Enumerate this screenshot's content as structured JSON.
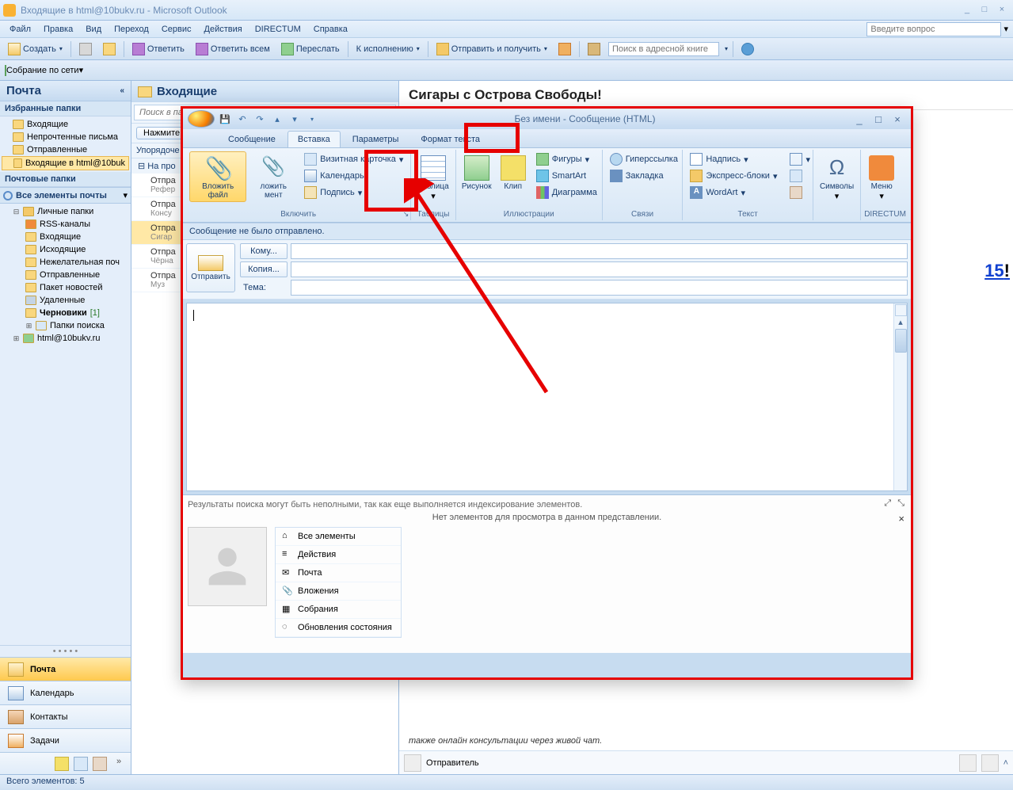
{
  "window": {
    "title": "Входящие в html@10bukv.ru - Microsoft Outlook"
  },
  "menubar": {
    "items": [
      "Файл",
      "Правка",
      "Вид",
      "Переход",
      "Сервис",
      "Действия",
      "DIRECTUM",
      "Справка"
    ],
    "ask_placeholder": "Введите вопрос"
  },
  "toolbar": {
    "create": "Создать",
    "reply": "Ответить",
    "reply_all": "Ответить всем",
    "forward": "Переслать",
    "followup": "К исполнению",
    "sendrecv": "Отправить и получить",
    "addrbook_placeholder": "Поиск в адресной книге"
  },
  "toolbar2": {
    "meeting": "Собрание по сети"
  },
  "nav": {
    "header": "Почта",
    "fav_hdr": "Избранные папки",
    "fav": [
      "Входящие",
      "Непрочтенные письма",
      "Отправленные",
      "Входящие в html@10buk"
    ],
    "mail_hdr": "Почтовые папки",
    "all_items": "Все элементы почты",
    "tree": {
      "root": "Личные папки",
      "children": [
        "RSS-каналы",
        "Входящие",
        "Исходящие",
        "Нежелательная поч",
        "Отправленные",
        "Пакет новостей",
        "Удаленные"
      ],
      "drafts": "Черновики",
      "drafts_count": "[1]",
      "search_folders": "Папки поиска",
      "account": "html@10bukv.ru"
    },
    "buttons": {
      "mail": "Почта",
      "calendar": "Календарь",
      "contacts": "Контакты",
      "tasks": "Задачи"
    }
  },
  "middle": {
    "header": "Входящие",
    "search_placeholder": "Поиск в папке \"Входящие\"",
    "today_btn": "Нажмите",
    "arrange": "Упорядоче",
    "group_header": "На про",
    "messages": [
      {
        "from": "Отпра",
        "sub": "Рефер"
      },
      {
        "from": "Отпра",
        "sub": "Консу"
      },
      {
        "from": "Отпра",
        "sub": "Сигар"
      },
      {
        "from": "Отпра",
        "sub": "Чёрна"
      },
      {
        "from": "Отпра",
        "sub": "Муз"
      }
    ]
  },
  "reading": {
    "subject": "Сигары с Острова Свободы!",
    "big_fragment": "15",
    "body_line": "также онлайн консультации через живой чат.",
    "sender_label": "Отправитель"
  },
  "compose": {
    "title": "Без имени - Сообщение (HTML)",
    "tabs": [
      "Сообщение",
      "Вставка",
      "Параметры",
      "Формат текста"
    ],
    "active_tab": 1,
    "ribbon": {
      "attach_file": "Вложить файл",
      "attach_item": "ложить мент",
      "bizcard": "Визитная карточка",
      "calendar": "Календарь",
      "signature": "Подпись",
      "grp_include": "Включить",
      "table": "Таблица",
      "grp_tables": "Таблицы",
      "picture": "Рисунок",
      "clip": "Клип",
      "shapes": "Фигуры",
      "smartart": "SmartArt",
      "chart": "Диаграмма",
      "grp_illus": "Иллюстрации",
      "hyperlink": "Гиперссылка",
      "bookmark": "Закладка",
      "grp_links": "Связи",
      "textbox": "Надпись",
      "quickparts": "Экспресс-блоки",
      "wordart": "WordArt",
      "grp_text": "Текст",
      "symbols": "Символы",
      "directum": "Меню",
      "grp_directum": "DIRECTUM"
    },
    "infobar": "Сообщение не было отправлено.",
    "send": "Отправить",
    "to_btn": "Кому...",
    "cc_btn": "Копия...",
    "subject_label": "Тема:",
    "contact": {
      "search_msg": "Результаты поиска могут быть неполными, так как еще выполняется индексирование элементов.",
      "noview": "Нет элементов для просмотра в данном представлении.",
      "items": [
        "Все элементы",
        "Действия",
        "Почта",
        "Вложения",
        "Собрания",
        "Обновления состояния"
      ]
    }
  },
  "statusbar": {
    "text": "Всего элементов: 5"
  }
}
